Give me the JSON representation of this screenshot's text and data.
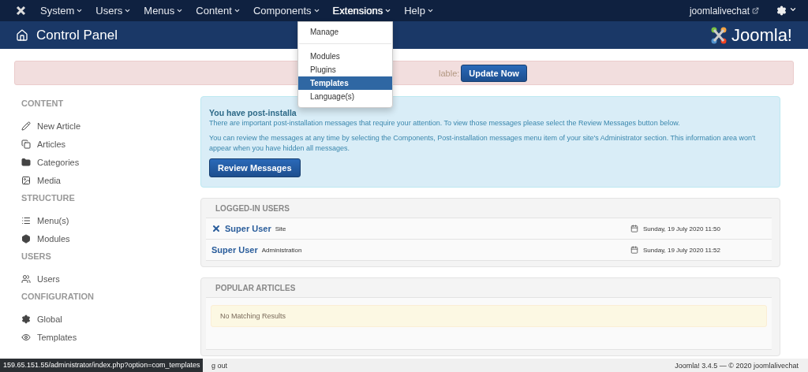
{
  "top_menu": [
    {
      "label": "System",
      "selected": false
    },
    {
      "label": "Users",
      "selected": false
    },
    {
      "label": "Menus",
      "selected": false
    },
    {
      "label": "Content",
      "selected": false
    },
    {
      "label": "Components",
      "selected": false
    },
    {
      "label": "Extensions",
      "selected": true
    },
    {
      "label": "Help",
      "selected": false
    }
  ],
  "site_link": "joomlalivechat",
  "header": {
    "title": "Control Panel",
    "logo_text": "Joomla!"
  },
  "dropdown": [
    [
      {
        "label": "Manage",
        "selected": false
      }
    ],
    [
      {
        "label": "Modules",
        "selected": false
      },
      {
        "label": "Plugins",
        "selected": false
      },
      {
        "label": "Templates",
        "selected": true
      },
      {
        "label": "Language(s)",
        "selected": false
      }
    ]
  ],
  "update_alert": {
    "text": "lable:",
    "button": "Update Now"
  },
  "sidebar": [
    {
      "heading": "CONTENT",
      "items": [
        "New Article",
        "Articles",
        "Categories",
        "Media"
      ]
    },
    {
      "heading": "STRUCTURE",
      "items": [
        "Menu(s)",
        "Modules"
      ]
    },
    {
      "heading": "USERS",
      "items": [
        "Users"
      ]
    },
    {
      "heading": "CONFIGURATION",
      "items": [
        "Global",
        "Templates"
      ]
    }
  ],
  "post_install": {
    "title": "You have post-installa",
    "lines": [
      "There are important post-installation messages that require your attention. To view those messages please select the Review Messages button below.",
      "You can review the messages at any time by selecting the Components, Post-installation messages menu item of your site's Administrator section. This information area won't appear when you have hidden all messages."
    ],
    "button": "Review Messages"
  },
  "logged_in": {
    "title": "LOGGED-IN USERS",
    "rows": [
      {
        "name": "Super User",
        "area": "Site",
        "date": "Sunday, 19 July 2020 11:50",
        "logout": true
      },
      {
        "name": "Super User",
        "area": "Administration",
        "date": "Sunday, 19 July 2020 11:52",
        "logout": false
      }
    ]
  },
  "popular": {
    "title": "POPULAR ARTICLES",
    "empty": "No Matching Results"
  },
  "status_bar": {
    "left": "g out",
    "right": "Joomla! 3.4.5 — © 2020 joomlalivechat"
  },
  "url_tooltip": "159.65.151.55/administrator/index.php?option=com_templates"
}
